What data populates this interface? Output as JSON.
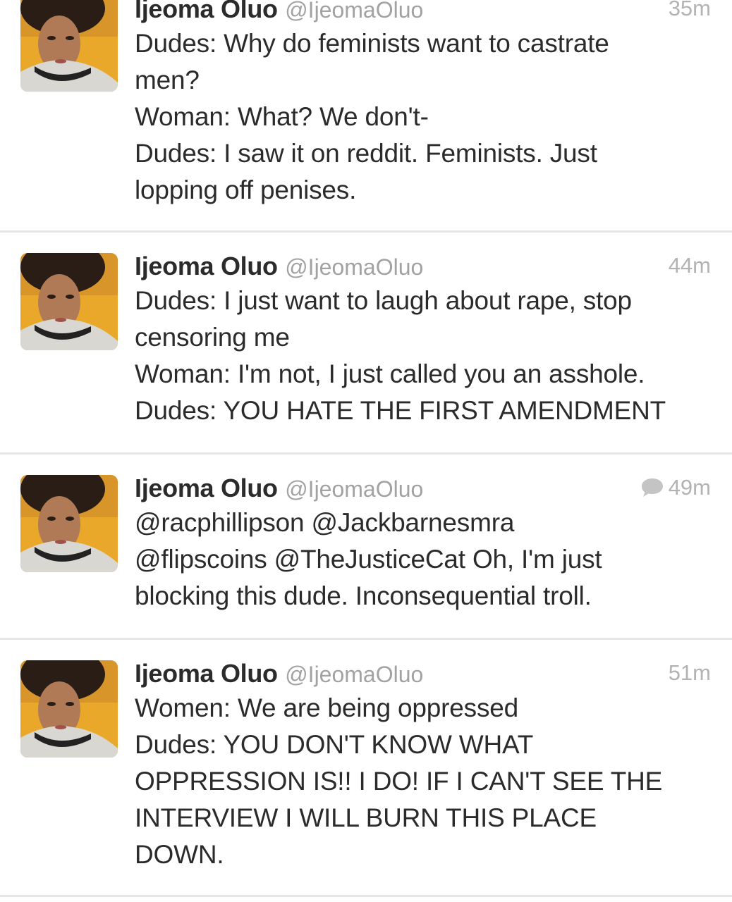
{
  "tweets": [
    {
      "name": "Ijeoma Oluo",
      "handle": "@IjeomaOluo",
      "time": "35m",
      "has_reply_icon": false,
      "lines": [
        "Dudes: Why do feminists want to castrate",
        "men?",
        "Woman: What? We don't-",
        "Dudes: I saw it on reddit. Feminists. Just",
        "lopping off penises."
      ]
    },
    {
      "name": "Ijeoma Oluo",
      "handle": "@IjeomaOluo",
      "time": "44m",
      "has_reply_icon": false,
      "lines": [
        "Dudes: I just want to laugh about rape, stop",
        "censoring me",
        "Woman: I'm not, I just called you an asshole.",
        "Dudes: YOU HATE THE FIRST AMENDMENT"
      ]
    },
    {
      "name": "Ijeoma Oluo",
      "handle": "@IjeomaOluo",
      "time": "49m",
      "has_reply_icon": true,
      "lines": [
        "@racphillipson @Jackbarnesmra",
        "@flipscoins @TheJusticeCat Oh, I'm just",
        "blocking this dude. Inconsequential troll."
      ]
    },
    {
      "name": "Ijeoma Oluo",
      "handle": "@IjeomaOluo",
      "time": "51m",
      "has_reply_icon": false,
      "lines": [
        "Women: We are being oppressed",
        "Dudes: YOU DON'T KNOW WHAT",
        "OPPRESSION IS!! I DO! IF I CAN'T SEE THE",
        "INTERVIEW I WILL BURN THIS PLACE",
        "DOWN."
      ]
    }
  ],
  "icons": {
    "avatar": "avatar-photo",
    "reply": "speech-bubble-icon"
  },
  "colors": {
    "text": "#2b2b2b",
    "handle": "#a2a2a2",
    "time": "#b3b3b3",
    "divider": "#e6e6e6"
  }
}
